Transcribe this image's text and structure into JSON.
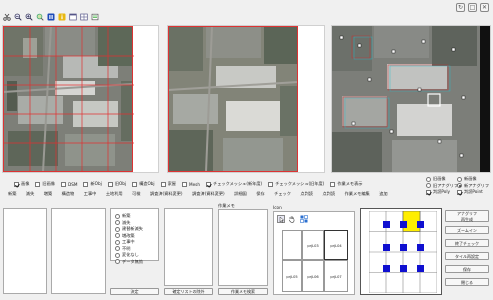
{
  "toolbar": {
    "icons": [
      "scissors-icon",
      "zoom-out-icon",
      "zoom-in-icon",
      "search-icon",
      "pause-icon",
      "info-icon",
      "window-icon",
      "window-split-icon",
      "export-icon"
    ]
  },
  "window_buttons": [
    "↻",
    "□",
    "✕"
  ],
  "layers": {
    "items": [
      {
        "label": "画像",
        "checked": true
      },
      {
        "label": "旧画像",
        "checked": false
      },
      {
        "label": "DSM",
        "checked": false
      },
      {
        "label": "新Obj",
        "checked": false
      },
      {
        "label": "旧Obj",
        "checked": false
      },
      {
        "label": "構造Obj",
        "checked": false
      },
      {
        "label": "家屋",
        "checked": false
      },
      {
        "label": "Mesh",
        "checked": false
      },
      {
        "label": "チェックメッシュ(新年度)",
        "checked": true
      },
      {
        "label": "チェックメッシュ(旧年度)",
        "checked": false
      },
      {
        "label": "作業メモ表示",
        "checked": false
      }
    ]
  },
  "view_options": [
    {
      "label": "旧画像",
      "type": "radio",
      "checked": false
    },
    {
      "label": "新画像",
      "type": "radio",
      "checked": false
    },
    {
      "label": "旧アナグリフ",
      "type": "radio",
      "checked": false
    },
    {
      "label": "新アナグリフ",
      "type": "radio",
      "checked": true
    },
    {
      "label": "判読Poly",
      "type": "check",
      "checked": true
    },
    {
      "label": "判読Point",
      "type": "check",
      "checked": true
    }
  ],
  "categories": [
    "新築",
    "滅失",
    "増築",
    "構造物",
    "工事中",
    "土地利用",
    "可検",
    "調査済(資料変更)",
    "調査済(資料変更)",
    "詳細図",
    "課税",
    "保存",
    "チェック",
    "点判読",
    "点判読",
    "作業メモ編集",
    "追加"
  ],
  "status_list": [
    "新築",
    "滅失",
    "建替新滅失",
    "増改築",
    "工事中",
    "不明",
    "変化なし",
    "データ無効"
  ],
  "buttons": {
    "decide": "決定",
    "confirm_list": "確定リストの除外",
    "memo_edit": "作業メモ検索",
    "analyze": "アナグリフ\n再生成",
    "zoom": "ズームイン",
    "finish_check": "終了チェック",
    "tile_reset": "タイル再設定",
    "save": "保存",
    "close": "閉じる"
  },
  "labels": {
    "memo": "作業メモ",
    "icon_panel": "Icon"
  },
  "tile_grid": {
    "cells": [
      "prjL05",
      "prjL04",
      "prjL06",
      "prjL07",
      "prjL03",
      "prjL08"
    ]
  },
  "selector": {
    "highlight_color": "#ffee00",
    "marker_color": "#1010d0"
  }
}
